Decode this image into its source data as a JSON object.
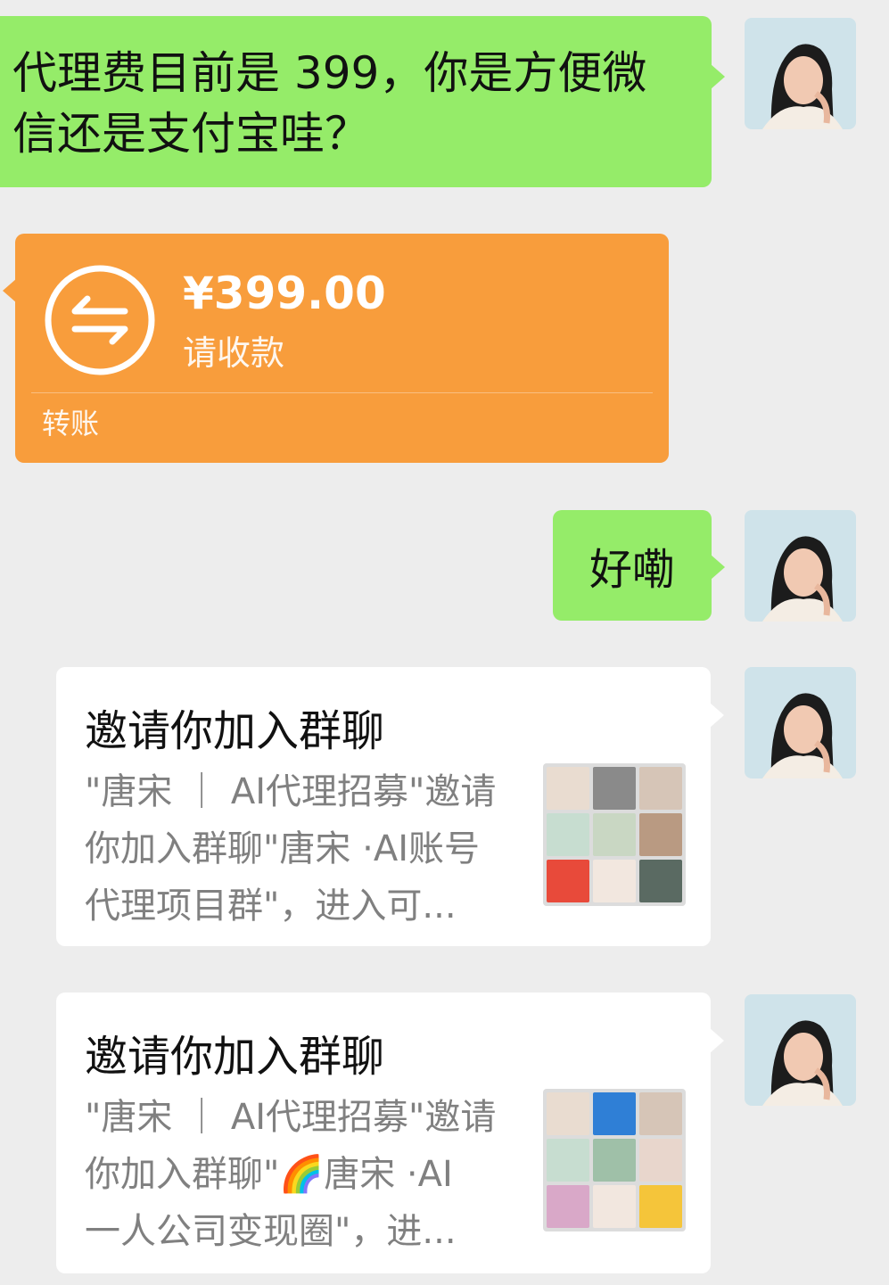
{
  "messages": {
    "msg1": {
      "text_line1": "代理费目前是 399，你是方便微",
      "text_line2": "信还是支付宝哇？"
    },
    "transfer": {
      "amount": "¥399.00",
      "status": "请收款",
      "footer": "转账",
      "icon": "transfer-arrows-icon"
    },
    "msg3": {
      "text": "好嘞"
    },
    "card1": {
      "title": "邀请你加入群聊",
      "desc_line1": "\"唐宋 ｜ AI代理招募\"邀请",
      "desc_line2": "你加入群聊\"唐宋 ·AI账号",
      "desc_line3": "代理项目群\"，进入可..."
    },
    "card2": {
      "title": "邀请你加入群聊",
      "desc_line1": "\"唐宋 ｜ AI代理招募\"邀请",
      "desc_line2": "你加入群聊\"🌈唐宋 ·AI",
      "desc_line3": "一人公司变现圈\"，进..."
    }
  },
  "colors": {
    "background": "#ededed",
    "green_bubble": "#95ec69",
    "transfer_orange": "#f89d3c"
  }
}
